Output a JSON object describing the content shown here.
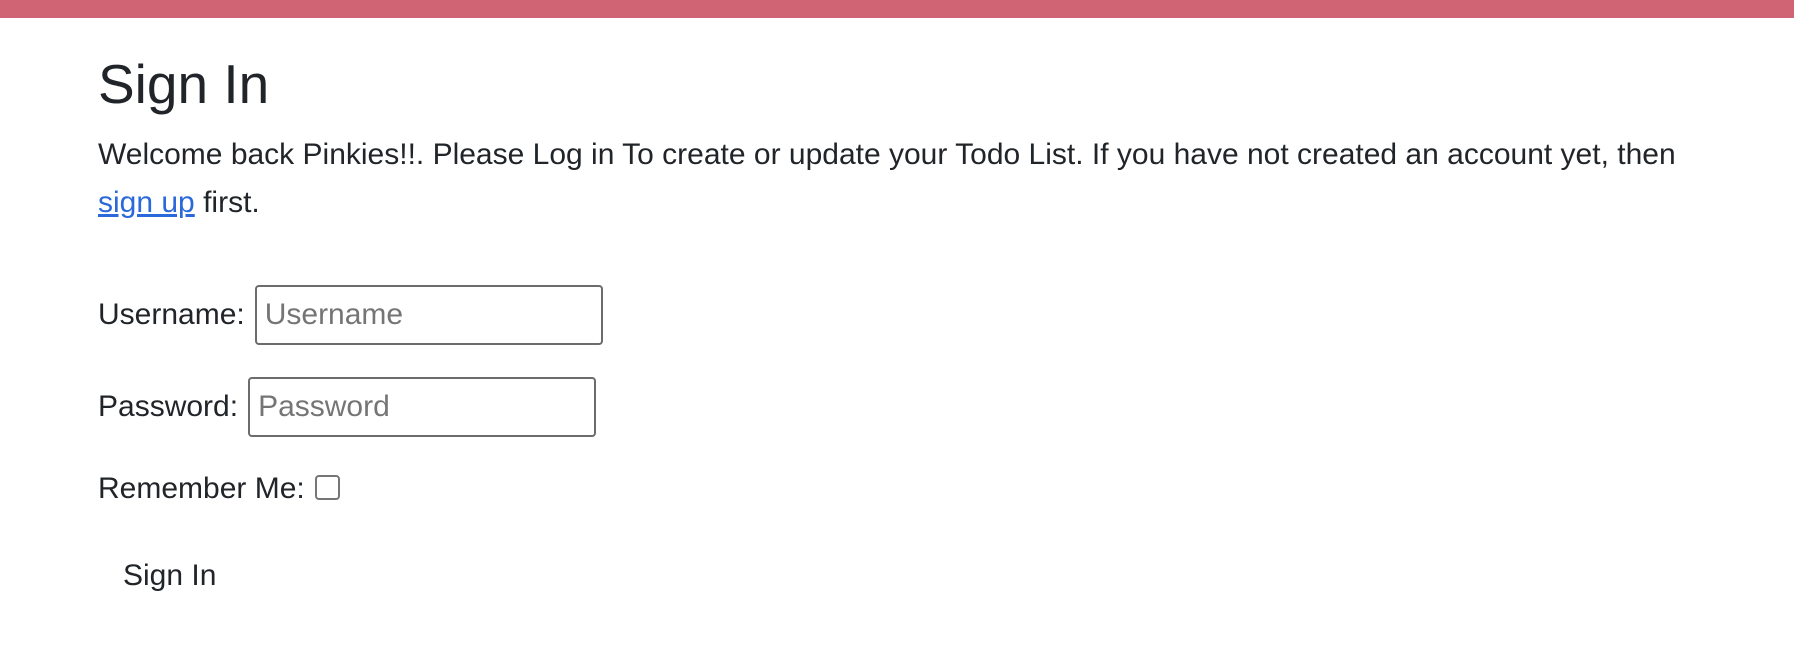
{
  "colors": {
    "top_bar": "#d16474",
    "link": "#2b68d9",
    "text": "#212529"
  },
  "page": {
    "title": "Sign In",
    "intro_before_link": "Welcome back Pinkies!!. Please Log in To create or update your Todo List. If you have not created an account yet, then ",
    "signup_link": "sign up",
    "intro_after_link": " first."
  },
  "form": {
    "username_label": "Username:",
    "username_placeholder": "Username",
    "username_value": "",
    "password_label": "Password:",
    "password_placeholder": "Password",
    "password_value": "",
    "remember_label": "Remember Me:",
    "remember_checked": false,
    "submit_label": "Sign In"
  }
}
